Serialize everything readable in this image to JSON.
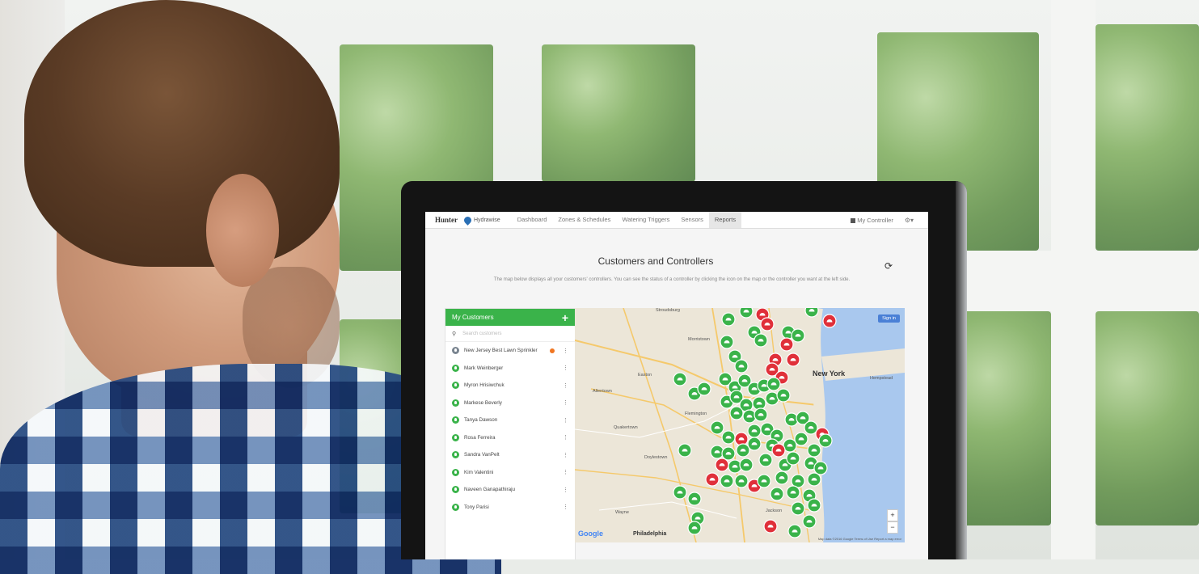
{
  "app": {
    "brand": "Hunter",
    "product": "Hydrawise"
  },
  "nav": {
    "items": [
      "Dashboard",
      "Zones & Schedules",
      "Watering Triggers",
      "Sensors",
      "Reports"
    ],
    "active": "Reports",
    "right_label": "My Controller"
  },
  "page": {
    "title": "Customers and Controllers",
    "description": "The map below displays all your customers' controllers. You can see the status of a controller by clicking the icon on the map or the controller you want at the left side."
  },
  "customers": {
    "header": "My Customers",
    "search_placeholder": "Search customers",
    "items": [
      {
        "name": "New Jersey Best Lawn Sprinkler",
        "status": "alert"
      },
      {
        "name": "Mark Weinberger",
        "status": "ok"
      },
      {
        "name": "Myron Hrisiwchuk",
        "status": "ok"
      },
      {
        "name": "Markese Beverly",
        "status": "ok"
      },
      {
        "name": "Tanya Dawson",
        "status": "ok"
      },
      {
        "name": "Rosa Ferreira",
        "status": "ok"
      },
      {
        "name": "Sandra VanPelt",
        "status": "ok"
      },
      {
        "name": "Kim Valentini",
        "status": "ok"
      },
      {
        "name": "Naveen Ganapathiraju",
        "status": "ok"
      },
      {
        "name": "Tony Parisi",
        "status": "ok"
      }
    ]
  },
  "map": {
    "labels": {
      "new_york": "New York",
      "philadelphia": "Philadelphia",
      "allentown": "Allentown",
      "hempstead": "Hempstead",
      "flemington": "Flemington",
      "doylestown": "Doylestown",
      "quakertown": "Quakertown",
      "easton": "Easton",
      "morristown": "Morristown",
      "jackson": "Jackson",
      "stroudsburg": "Stroudsburg",
      "wayne": "Wayne"
    },
    "sign_in": "Sign in",
    "zoom_in": "+",
    "zoom_out": "−",
    "google": "Google",
    "attribution": "Map data ©2016 Google   Terms of Use   Report a map error",
    "colors": {
      "ok": "#3ab34a",
      "alert": "#e0303a",
      "water": "#a9c8ee",
      "land": "#ece6d8"
    }
  }
}
